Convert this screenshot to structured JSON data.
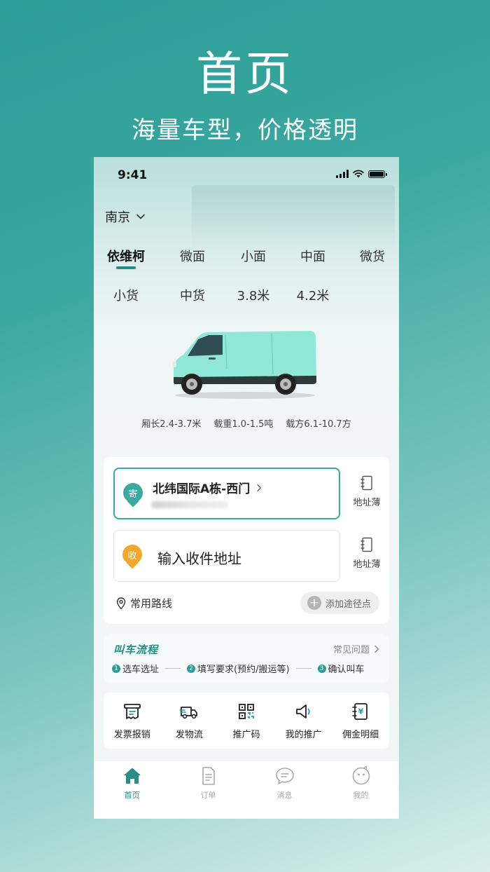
{
  "promo": {
    "title": "首页",
    "subtitle": "海量车型，价格透明"
  },
  "status_bar": {
    "time": "9:41"
  },
  "header": {
    "city": "南京"
  },
  "categories": {
    "row1": [
      "依维柯",
      "微面",
      "小面",
      "中面",
      "微货"
    ],
    "row2": [
      "小货",
      "中货",
      "3.8米",
      "4.2米"
    ],
    "selected": "依维柯"
  },
  "vehicle": {
    "specs": [
      "厢长2.4-3.7米",
      "载重1.0-1.5吨",
      "载方6.1-10.7方"
    ],
    "color": "#8fe8d5"
  },
  "address": {
    "sender_badge": "寄",
    "sender_name": "北纬国际A栋-西门",
    "receiver_badge": "收",
    "receiver_placeholder": "输入收件地址",
    "address_book_label": "地址薄",
    "common_routes": "常用路线",
    "add_waypoint": "添加途径点"
  },
  "flow": {
    "title": "叫车流程",
    "faq": "常见问题",
    "steps": [
      {
        "num": "1",
        "label": "选车选址"
      },
      {
        "num": "2",
        "label": "填写要求(预约/搬运等)"
      },
      {
        "num": "3",
        "label": "确认叫车"
      }
    ]
  },
  "tools": [
    {
      "label": "发票报销",
      "icon": "invoice-icon"
    },
    {
      "label": "发物流",
      "icon": "truck-icon"
    },
    {
      "label": "推广码",
      "icon": "qr-code-icon"
    },
    {
      "label": "我的推广",
      "icon": "megaphone-icon"
    },
    {
      "label": "佣金明细",
      "icon": "commission-icon"
    }
  ],
  "tabs": [
    {
      "label": "首页",
      "icon": "home-icon",
      "active": true
    },
    {
      "label": "订单",
      "icon": "order-icon",
      "active": false
    },
    {
      "label": "消息",
      "icon": "message-icon",
      "active": false
    },
    {
      "label": "我的",
      "icon": "profile-icon",
      "active": false
    }
  ],
  "colors": {
    "accent": "#2a9d96",
    "sender_pin": "#3aa9a0",
    "receiver_pin": "#f3a72d",
    "flow_title": "#1f8f87"
  }
}
